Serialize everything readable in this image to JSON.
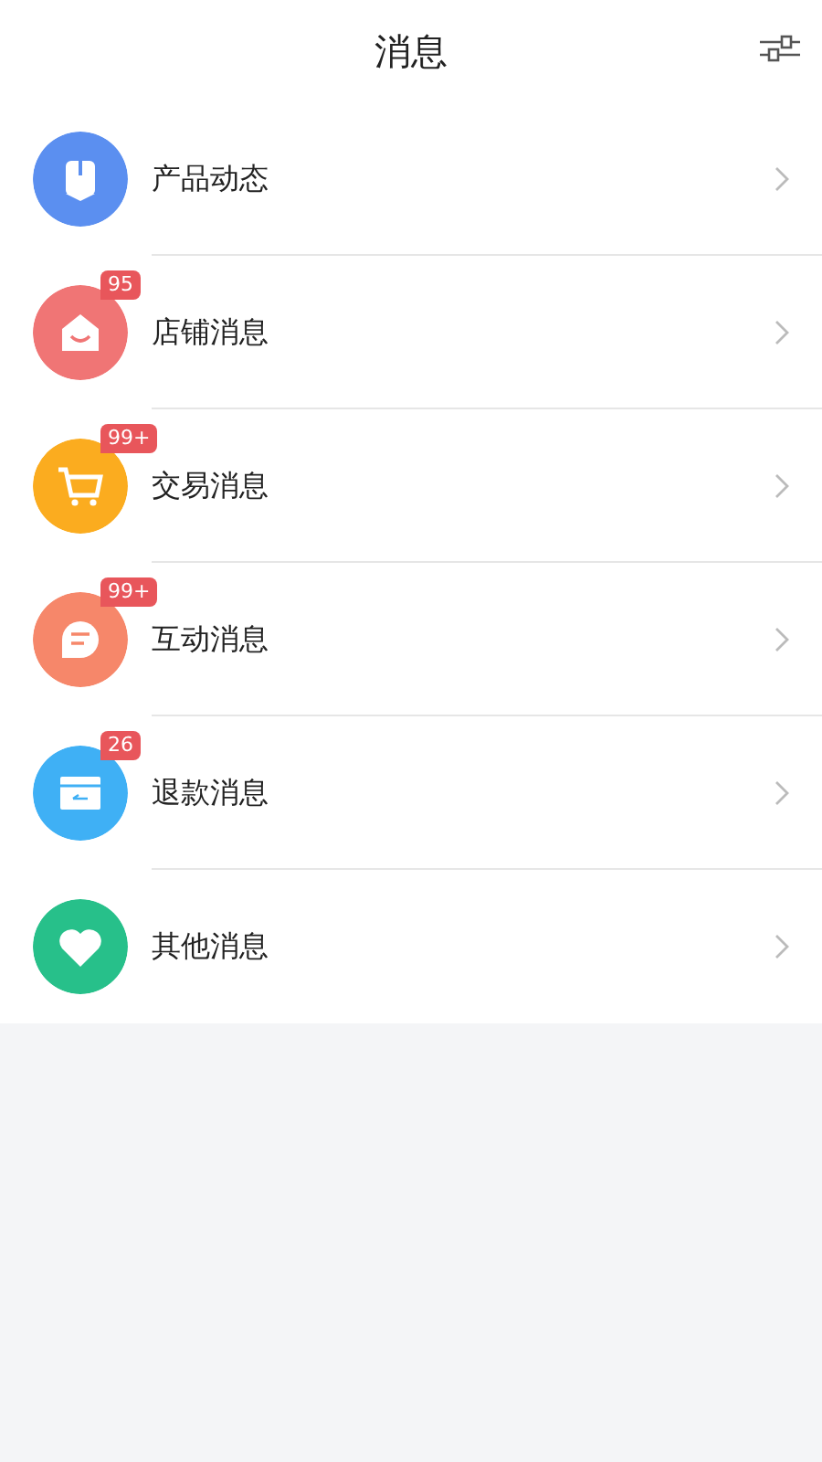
{
  "header": {
    "title": "消息"
  },
  "items": [
    {
      "label": "产品动态",
      "kind": "book",
      "color": "#5b8ff0"
    },
    {
      "label": "店铺消息",
      "kind": "shop",
      "color": "#f07575",
      "badge": "95"
    },
    {
      "label": "交易消息",
      "kind": "cart",
      "color": "#fbac1f",
      "badge": "99+"
    },
    {
      "label": "互动消息",
      "kind": "chat",
      "color": "#f6876a",
      "badge": "99+"
    },
    {
      "label": "退款消息",
      "kind": "card",
      "color": "#3fb0f5",
      "badge": "26"
    },
    {
      "label": "其他消息",
      "kind": "heart",
      "color": "#27c08a"
    }
  ]
}
